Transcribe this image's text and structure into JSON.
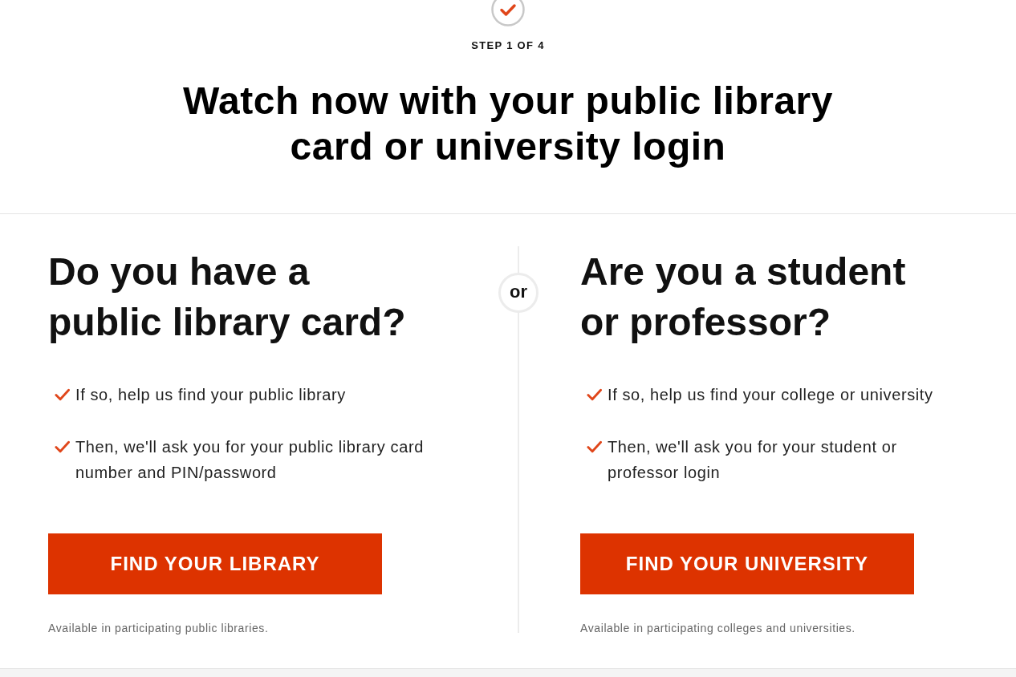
{
  "progress": {
    "completed": true,
    "step_label": "STEP 1 OF 4"
  },
  "heading": "Watch now with your public library card or university login",
  "separator": {
    "label": "or"
  },
  "options": [
    {
      "title": "Do you have a public library card?",
      "points": [
        "If so, help us find your public library",
        "Then, we'll ask you for your public library card number and PIN/password"
      ],
      "button": "FIND YOUR LIBRARY",
      "note": "Available in participating public libraries."
    },
    {
      "title": "Are you a student or professor?",
      "points": [
        "If so, help us find your college or university",
        "Then, we'll ask you for your student or professor login"
      ],
      "button": "FIND YOUR UNIVERSITY",
      "note": "Available in participating colleges and universities."
    }
  ]
}
